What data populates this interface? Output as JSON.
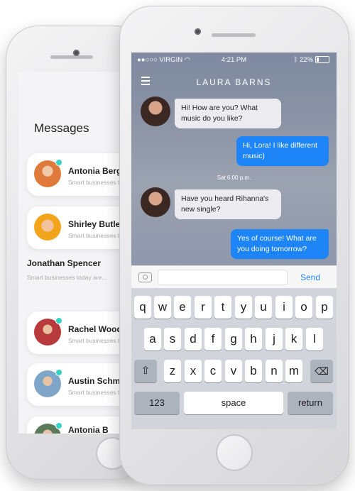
{
  "back_phone": {
    "title": "Messages",
    "contacts": [
      {
        "name": "Antonia Berger",
        "preview": "Smart businesses today"
      },
      {
        "name": "Shirley Butler",
        "preview": "Smart businesses today"
      },
      {
        "name": "Jonathan Spencer",
        "preview": "Smart businesses today are..."
      },
      {
        "name": "Rachel Woods",
        "preview": "Smart businesses today"
      },
      {
        "name": "Austin Schmidt",
        "preview": "Smart businesses today"
      },
      {
        "name": "Antonia B",
        "preview": ""
      }
    ]
  },
  "status_bar": {
    "carrier": "VIRGIN",
    "time": "4:21 PM",
    "battery": "22%"
  },
  "chat": {
    "title": "LAURA BARNS",
    "messages": [
      {
        "side": "in",
        "text": "Hi! How are you? What music do you like?"
      },
      {
        "side": "out",
        "text": "Hi, Lora! I like different music)"
      },
      {
        "side": "time",
        "text": "Sat 6:00 p.m."
      },
      {
        "side": "in",
        "text": "Have you heard Rihanna's new single?"
      },
      {
        "side": "out",
        "text": "Yes of course! What are you doing tomorrow?"
      }
    ],
    "input_placeholder": "",
    "send_label": "Send"
  },
  "keyboard": {
    "row1": [
      "q",
      "w",
      "e",
      "r",
      "t",
      "y",
      "u",
      "i",
      "o",
      "p"
    ],
    "row2": [
      "a",
      "s",
      "d",
      "f",
      "g",
      "h",
      "j",
      "k",
      "l"
    ],
    "row3": [
      "z",
      "x",
      "c",
      "v",
      "b",
      "n",
      "m"
    ],
    "numbers_label": "123",
    "space_label": "space",
    "return_label": "return"
  },
  "colors": {
    "accent": "#1d85f7",
    "online": "#36d3c7"
  }
}
